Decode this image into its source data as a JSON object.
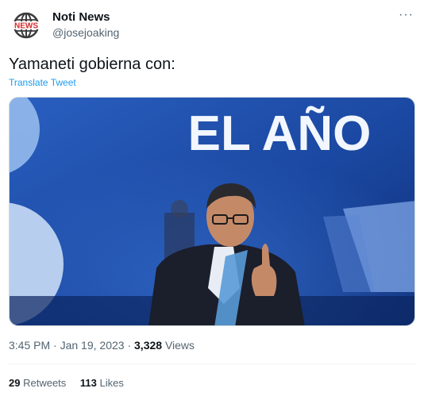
{
  "account": {
    "name": "Noti News",
    "handle": "@josejoaking",
    "logo_text": "NEWS"
  },
  "tweet": {
    "text": "Yamaneti gobierna con:",
    "translate_label": "Translate Tweet",
    "media": {
      "headline": "EL AÑO"
    },
    "time": "3:45 PM",
    "separator": "·",
    "date": "Jan 19, 2023",
    "views_count": "3,328",
    "views_label": "Views"
  },
  "stats": {
    "retweets_count": "29",
    "retweets_label": "Retweets",
    "likes_count": "113",
    "likes_label": "Likes"
  },
  "menu": {
    "more_label": "···"
  },
  "colors": {
    "link": "#1d9bf0",
    "secondary_text": "#536471",
    "logo_red": "#d62828",
    "stage_blue": "#1f4fa6"
  }
}
